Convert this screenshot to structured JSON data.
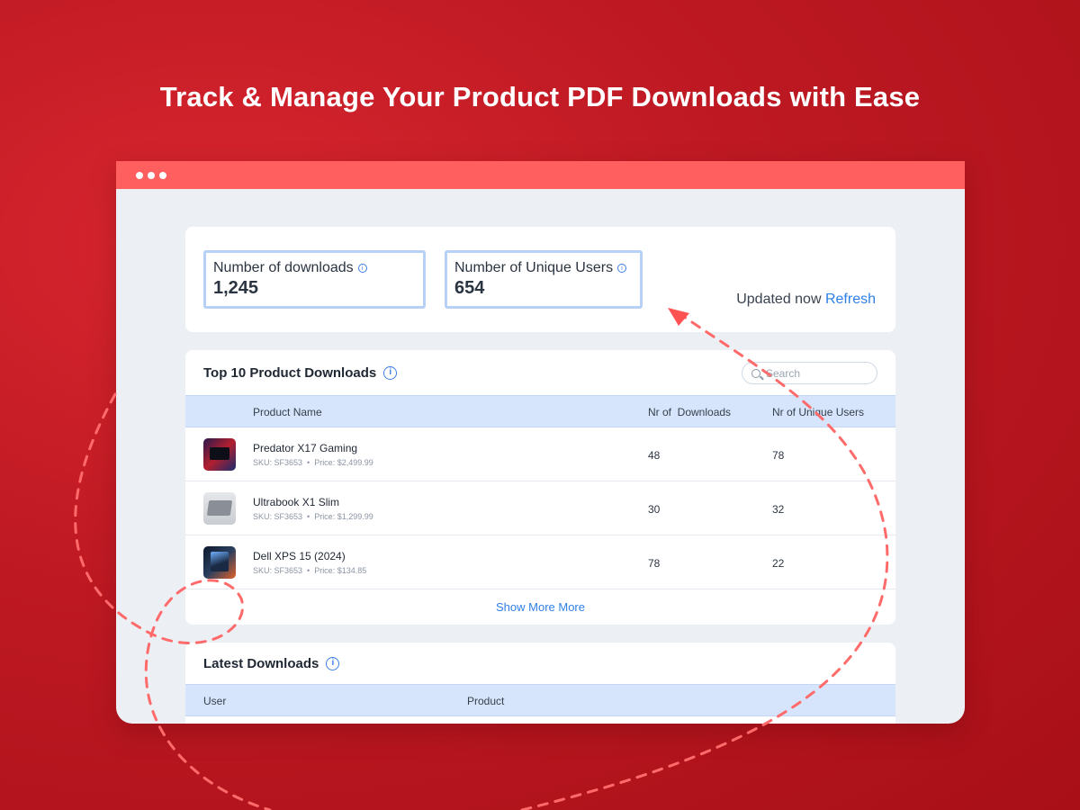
{
  "hero": {
    "title": "Track & Manage Your Product PDF Downloads with Ease"
  },
  "stats": {
    "downloads": {
      "label": "Number of downloads",
      "value": "1,245"
    },
    "unique_users": {
      "label": "Number of Unique Users",
      "value": "654"
    },
    "updated_text": "Updated now",
    "refresh_label": "Refresh"
  },
  "top_products": {
    "title": "Top 10 Product Downloads",
    "search_placeholder": "Search",
    "columns": [
      "Product Name",
      "Nr of  Downloads",
      "Nr of Unique Users"
    ],
    "rows": [
      {
        "name": "Predator X17 Gaming",
        "sku": "SKU: SF3653",
        "price": "Price: $2,499.99",
        "downloads": "48",
        "users": "78"
      },
      {
        "name": "Ultrabook X1 Slim",
        "sku": "SKU: SF3653",
        "price": "Price: $1,299.99",
        "downloads": "30",
        "users": "32"
      },
      {
        "name": "Dell XPS 15 (2024)",
        "sku": "SKU: SF3653",
        "price": "Price: $134.85",
        "downloads": "78",
        "users": "22"
      }
    ],
    "show_more_label": "Show More More"
  },
  "latest": {
    "title": "Latest Downloads",
    "columns": [
      "User",
      "Product"
    ]
  },
  "colors": {
    "titlebar": "#ff5f5f",
    "accent": "#2f7fe6",
    "background": "#c01a24",
    "dash": "#ff6b6b"
  },
  "icons": {
    "info": "info-icon",
    "search": "search-icon"
  }
}
